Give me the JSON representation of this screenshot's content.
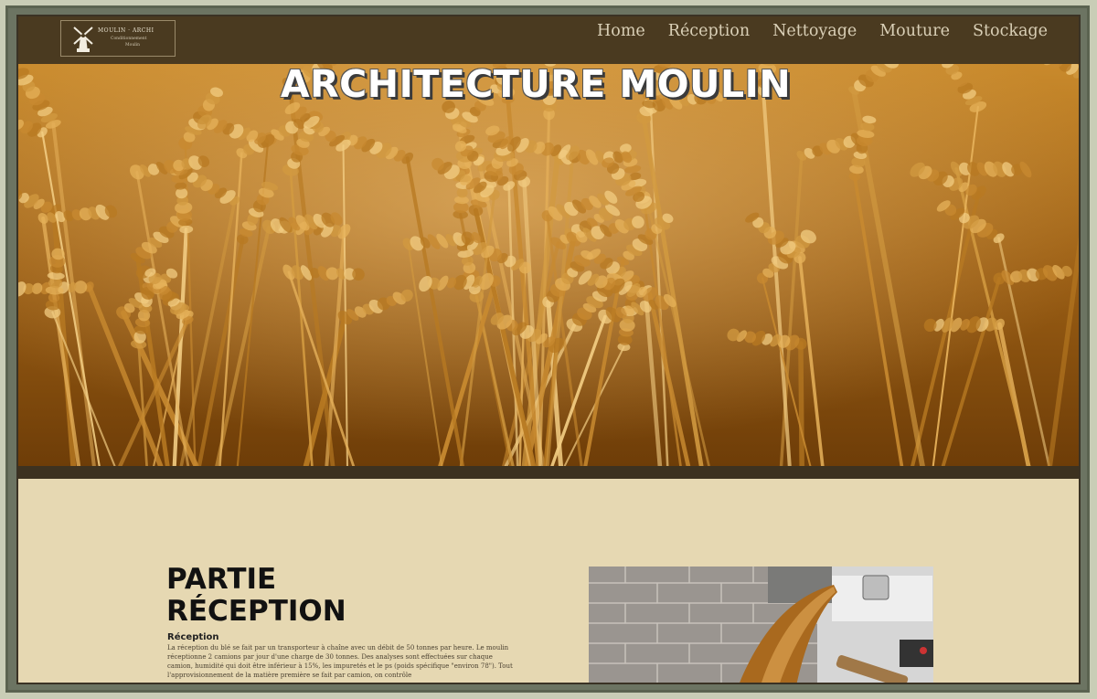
{
  "logo": {
    "line1": "MOULIN · ARCHI",
    "line2": "Conditionnement",
    "line3": "Moulin"
  },
  "nav": {
    "items": [
      "Home",
      "Réception",
      "Nettoyage",
      "Mouture",
      "Stockage"
    ]
  },
  "hero": {
    "title": "ARCHITECTURE MOULIN"
  },
  "section": {
    "title_line1": "PARTIE",
    "title_line2": "RÉCEPTION",
    "subtitle": "Réception",
    "body": "La réception du blé se fait par un transporteur à chaîne avec un débit de 50 tonnes par heure. Le moulin réceptionne 2 camions par jour d'une charge de 30 tonnes. Des analyses sont effectuées sur chaque camion, humidité qui doit être inférieur à 15%, les impuretés et le ps (poids spécifique \"environ 78\"). Tout l'approvisionnement de la matière première se fait par camion, on contrôle"
  },
  "colors": {
    "nav_bg": "#4a3a20",
    "band": "#3d3220",
    "content_bg": "#e6d8b2",
    "nav_text": "#d9cfb6",
    "frame": "#c9cdb6"
  },
  "icons": {
    "logo": "windmill-icon"
  }
}
